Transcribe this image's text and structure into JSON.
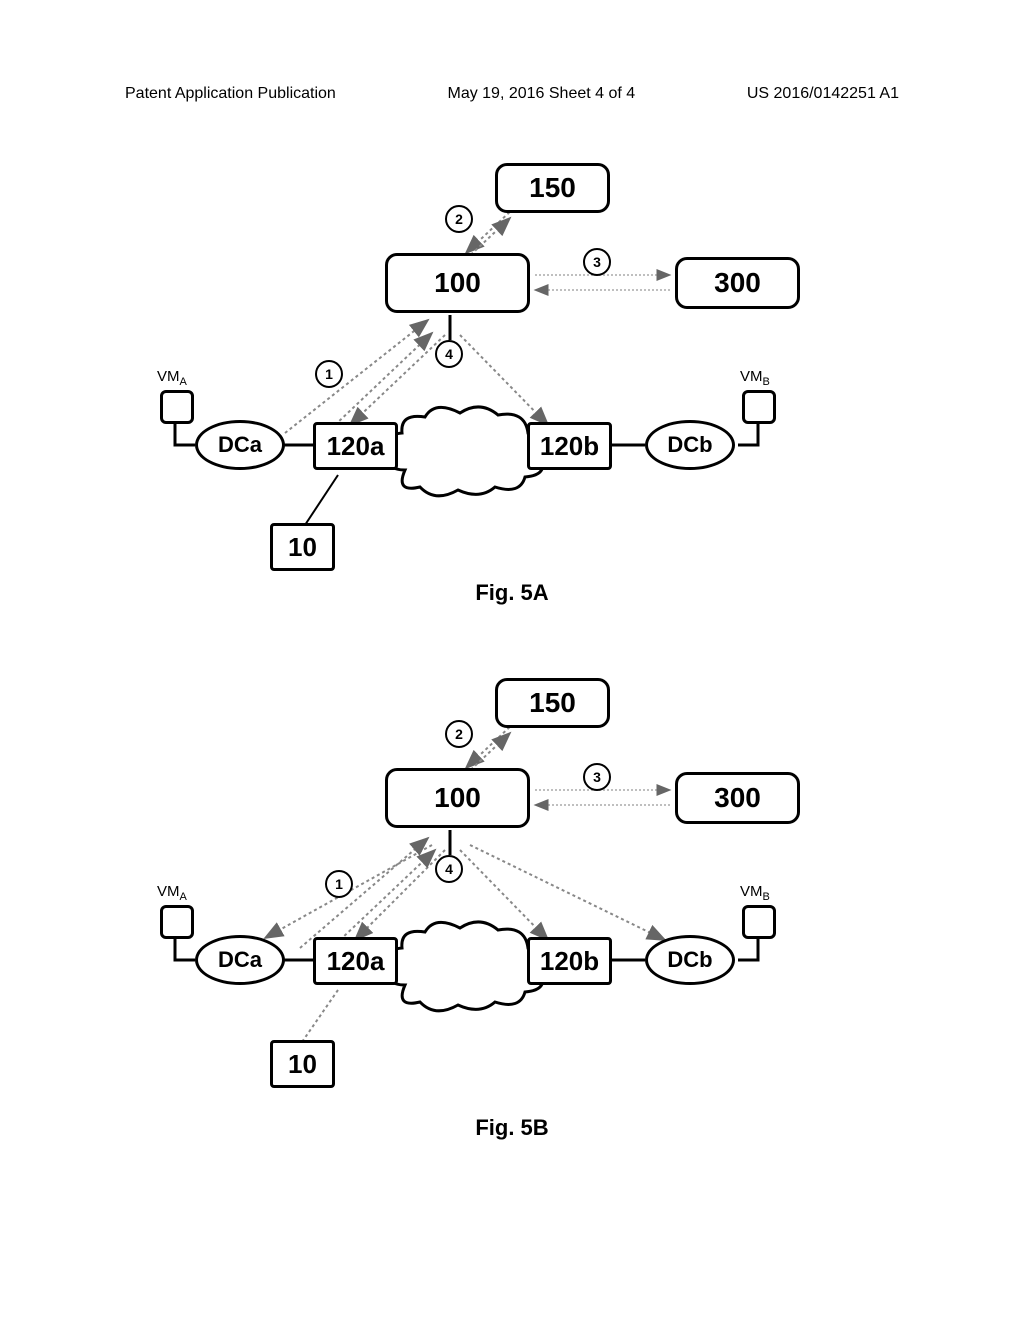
{
  "header": {
    "left": "Patent Application Publication",
    "center": "May 19, 2016  Sheet 4 of 4",
    "right": "US 2016/0142251 A1"
  },
  "figures": {
    "a": {
      "label": "Fig. 5A",
      "box150": "150",
      "box100": "100",
      "box300": "300",
      "box120a": "120a",
      "box120b": "120b",
      "box10": "10",
      "dca": "DCa",
      "dcb": "DCb",
      "vma": "VM",
      "vma_sub": "A",
      "vmb": "VM",
      "vmb_sub": "B",
      "step1": "1",
      "step2": "2",
      "step3": "3",
      "step4": "4"
    },
    "b": {
      "label": "Fig. 5B",
      "box150": "150",
      "box100": "100",
      "box300": "300",
      "box120a": "120a",
      "box120b": "120b",
      "box10": "10",
      "dca": "DCa",
      "dcb": "DCb",
      "vma": "VM",
      "vma_sub": "A",
      "vmb": "VM",
      "vmb_sub": "B",
      "step1": "1",
      "step2": "2",
      "step3": "3",
      "step4": "4"
    }
  }
}
